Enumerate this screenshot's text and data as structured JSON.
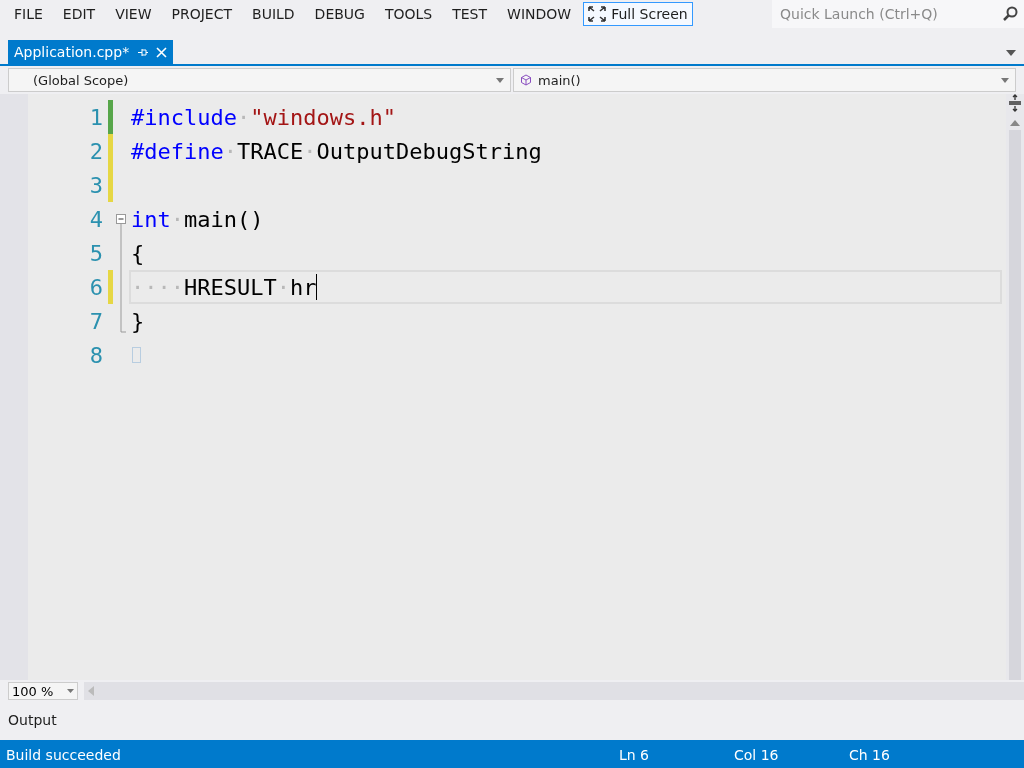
{
  "menu": [
    {
      "label": "FILE"
    },
    {
      "label": "EDIT"
    },
    {
      "label": "VIEW"
    },
    {
      "label": "PROJECT"
    },
    {
      "label": "BUILD"
    },
    {
      "label": "DEBUG"
    },
    {
      "label": "TOOLS"
    },
    {
      "label": "TEST"
    },
    {
      "label": "WINDOW"
    }
  ],
  "full_screen_button": {
    "label": "Full Screen"
  },
  "quick_launch": {
    "placeholder": "Quick Launch (Ctrl+Q)"
  },
  "tabs": [
    {
      "title": "Application.cpp*",
      "selected": true
    }
  ],
  "scope_dropdown": {
    "value": "(Global Scope)"
  },
  "member_dropdown": {
    "value": "main()"
  },
  "lines": [
    {
      "number": "1",
      "modified": true,
      "saved": true,
      "current": false,
      "tokens": [
        {
          "kind": "keyword",
          "text": "#include"
        },
        {
          "kind": "ws",
          "text": "·"
        },
        {
          "kind": "string",
          "text": "\"windows.h\""
        }
      ]
    },
    {
      "number": "2",
      "modified": true,
      "saved": false,
      "current": false,
      "tokens": [
        {
          "kind": "keyword",
          "text": "#define"
        },
        {
          "kind": "ws",
          "text": "·"
        },
        {
          "kind": "plain",
          "text": "TRACE"
        },
        {
          "kind": "ws",
          "text": "·"
        },
        {
          "kind": "plain",
          "text": "OutputDebugString"
        }
      ]
    },
    {
      "number": "3",
      "modified": true,
      "saved": false,
      "current": false
    },
    {
      "number": "4",
      "modified": false,
      "saved": false,
      "current": false,
      "fold_start": true,
      "tokens": [
        {
          "kind": "keyword",
          "text": "int"
        },
        {
          "kind": "ws",
          "text": "·"
        },
        {
          "kind": "plain",
          "text": "main()"
        }
      ]
    },
    {
      "number": "5",
      "modified": false,
      "saved": false,
      "current": false,
      "in_fold": true,
      "tokens": [
        {
          "kind": "plain",
          "text": "{"
        }
      ]
    },
    {
      "number": "6",
      "modified": true,
      "saved": false,
      "current": true,
      "in_fold": true,
      "tokens": [
        {
          "kind": "ws",
          "text": "····"
        },
        {
          "kind": "plain",
          "text": "HRESULT"
        },
        {
          "kind": "ws",
          "text": "·"
        },
        {
          "kind": "plain",
          "text": "hr"
        }
      ]
    },
    {
      "number": "7",
      "modified": false,
      "saved": false,
      "current": false,
      "fold_end": true,
      "tokens": [
        {
          "kind": "plain",
          "text": "}"
        }
      ]
    },
    {
      "number": "8",
      "modified": false,
      "saved": false,
      "current": false,
      "end_marker": true
    }
  ],
  "zoom": {
    "value": "100 %"
  },
  "output_panel": {
    "title": "Output"
  },
  "status_bar": {
    "message": "Build succeeded",
    "line": "Ln 6",
    "column": "Col 16",
    "char": "Ch 16"
  }
}
